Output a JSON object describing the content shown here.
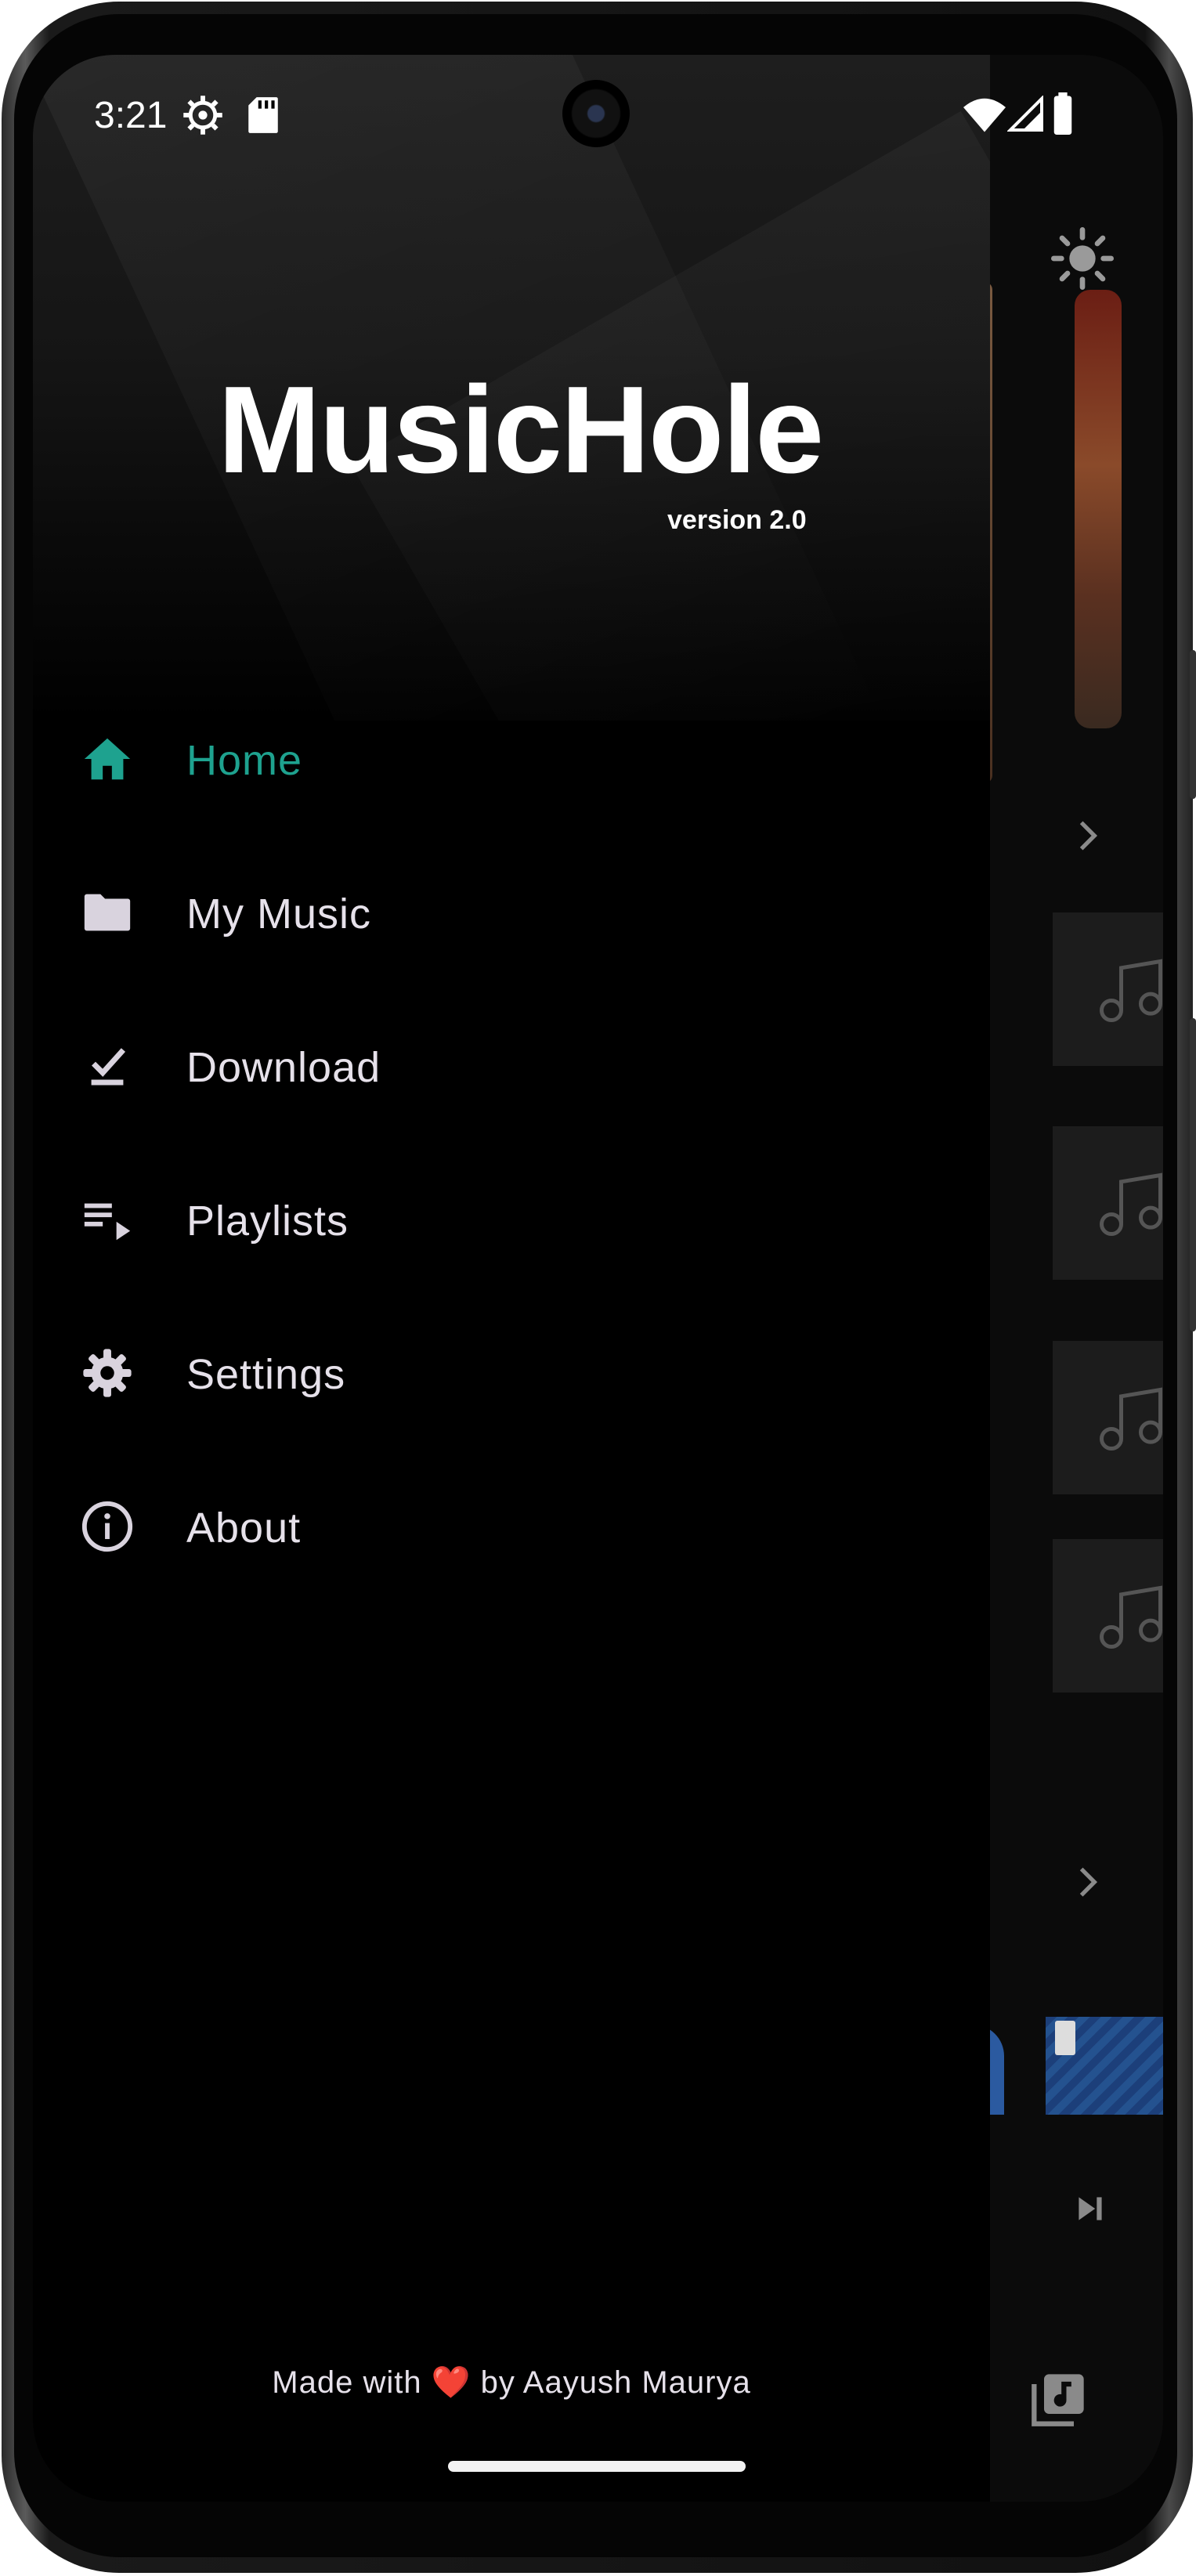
{
  "status_bar": {
    "time": "3:21",
    "icons": [
      "settings-gear-icon",
      "sd-card-icon",
      "wifi-icon",
      "cellular-signal-icon",
      "battery-icon"
    ]
  },
  "drawer": {
    "title": "MusicHole",
    "version": "version 2.0",
    "menu": [
      {
        "label": "Home",
        "icon": "home-icon",
        "active": true
      },
      {
        "label": "My Music",
        "icon": "folder-icon",
        "active": false
      },
      {
        "label": "Download",
        "icon": "download-done-icon",
        "active": false
      },
      {
        "label": "Playlists",
        "icon": "playlist-play-icon",
        "active": false
      },
      {
        "label": "Settings",
        "icon": "gear-icon",
        "active": false
      },
      {
        "label": "About",
        "icon": "info-icon",
        "active": false
      }
    ],
    "footer": {
      "prefix": "Made with",
      "heart": "❤️",
      "suffix": "by Aayush Maurya"
    }
  },
  "colors": {
    "accent": "#1ea28f",
    "text": "#e6e1ea",
    "drawer_bg": "#000000"
  }
}
